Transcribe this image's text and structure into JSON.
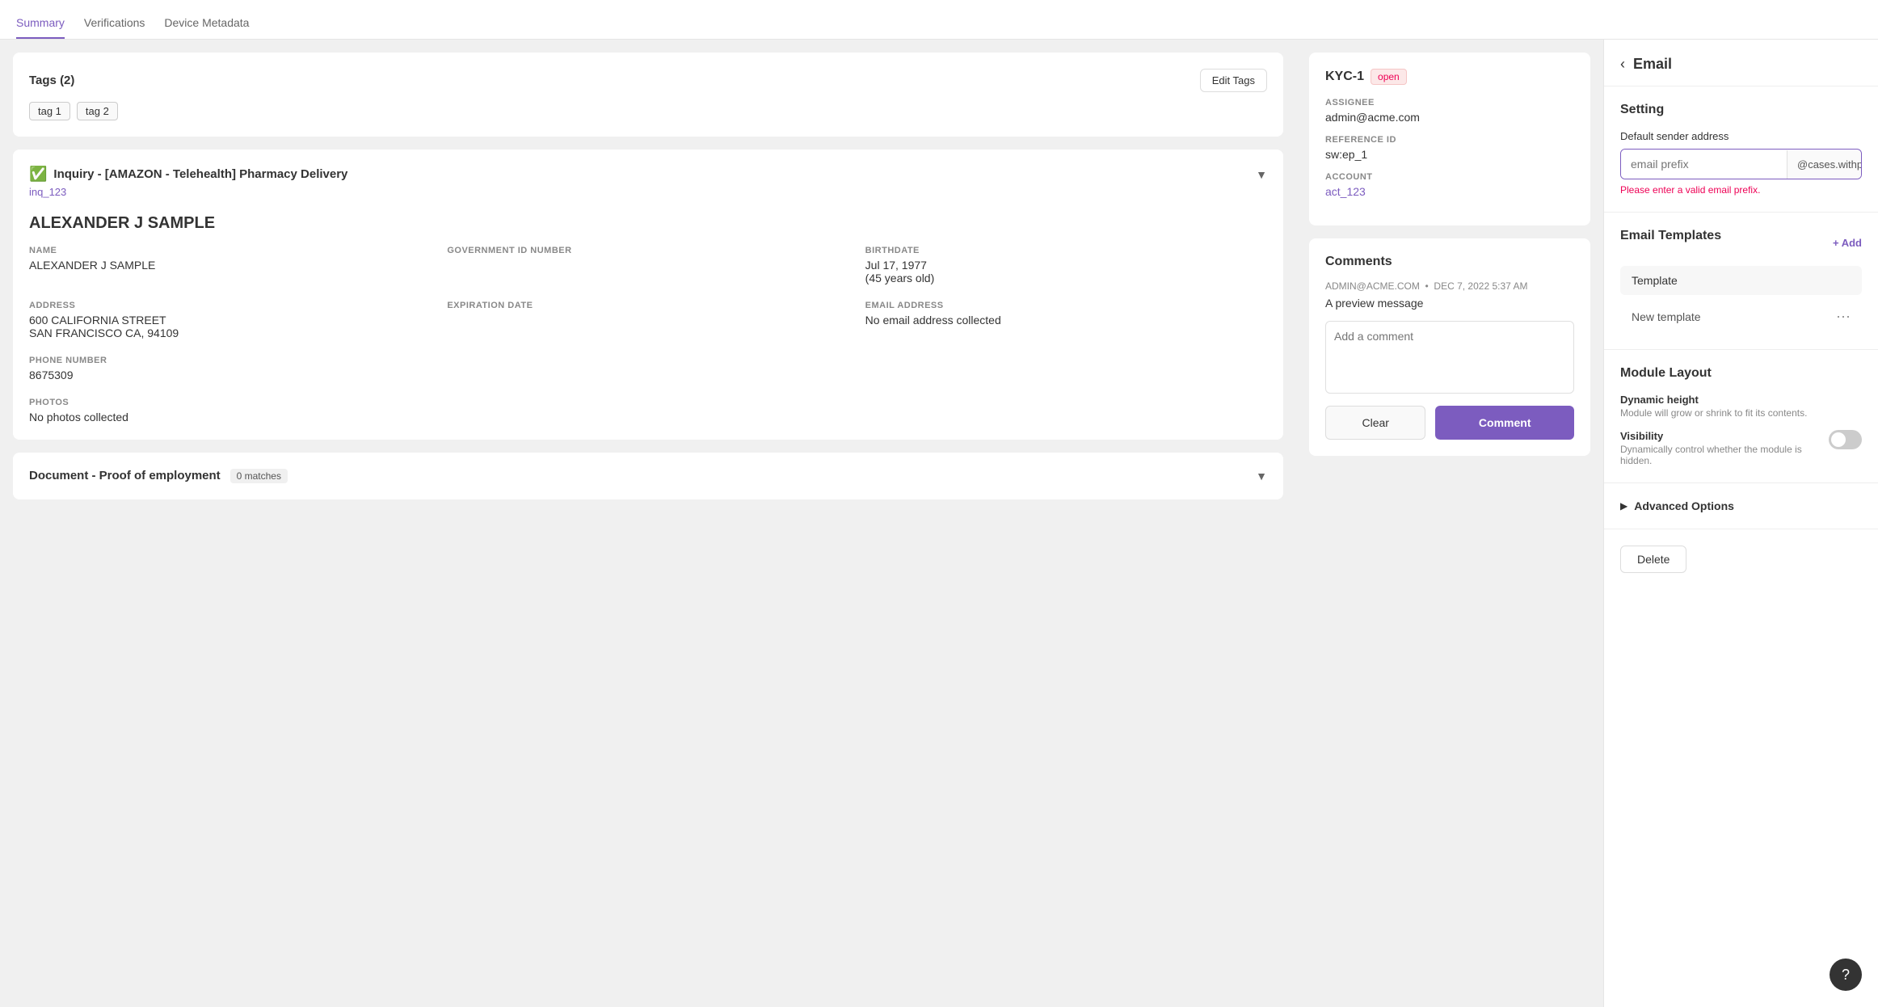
{
  "tabs": [
    {
      "id": "summary",
      "label": "Summary",
      "active": true
    },
    {
      "id": "verifications",
      "label": "Verifications",
      "active": false
    },
    {
      "id": "device-metadata",
      "label": "Device Metadata",
      "active": false
    }
  ],
  "tags_card": {
    "title": "Tags (2)",
    "edit_button": "Edit Tags",
    "tags": [
      "tag 1",
      "tag 2"
    ]
  },
  "inquiry_card": {
    "title": "Inquiry - [AMAZON - Telehealth] Pharmacy Delivery",
    "link_text": "inq_123"
  },
  "person": {
    "name": "ALEXANDER J SAMPLE",
    "fields": [
      {
        "label": "NAME",
        "value": "ALEXANDER J SAMPLE"
      },
      {
        "label": "GOVERNMENT ID NUMBER",
        "value": ""
      },
      {
        "label": "BIRTHDATE",
        "value": "Jul 17, 1977\n(45 years old)"
      },
      {
        "label": "ADDRESS",
        "value": "600 CALIFORNIA STREET\nSAN FRANCISCO CA, 94109"
      },
      {
        "label": "EXPIRATION DATE",
        "value": ""
      },
      {
        "label": "EMAIL ADDRESS",
        "value": "No email address collected"
      },
      {
        "label": "PHONE NUMBER",
        "value": "8675309"
      }
    ]
  },
  "photos": {
    "label": "PHOTOS",
    "value": "No photos collected"
  },
  "document_card": {
    "title": "Document - Proof of employment",
    "badge": "0 matches"
  },
  "kyc_card": {
    "id": "KYC-1",
    "status": "open",
    "assignee_label": "ASSIGNEE",
    "assignee_value": "admin@acme.com",
    "reference_label": "REFERENCE ID",
    "reference_value": "sw:ep_1",
    "account_label": "ACCOUNT",
    "account_link": "act_123"
  },
  "comments": {
    "title": "Comments",
    "author": "ADMIN@ACME.COM",
    "date": "DEC 7, 2022 5:37 AM",
    "message": "A preview message",
    "textarea_placeholder": "Add a comment",
    "clear_button": "Clear",
    "comment_button": "Comment"
  },
  "right_panel": {
    "back_icon": "‹",
    "title": "Email",
    "setting_section": {
      "title": "Setting",
      "sender_label": "Default sender address",
      "email_prefix_placeholder": "email prefix",
      "email_suffix": "@cases.withpersona.com",
      "error_text": "Please enter a valid email prefix."
    },
    "email_templates": {
      "title": "Email Templates",
      "add_button": "+ Add",
      "template_item": "Template",
      "new_template_item": "New template",
      "new_template_menu": "···"
    },
    "module_layout": {
      "title": "Module Layout",
      "dynamic_height_title": "Dynamic height",
      "dynamic_height_desc": "Module will grow or shrink to fit its contents.",
      "visibility_title": "Visibility",
      "visibility_desc": "Dynamically control whether the module is hidden."
    },
    "advanced_options": {
      "title": "Advanced Options",
      "arrow": "▶"
    },
    "delete_button": "Delete"
  },
  "help": {
    "icon": "?"
  }
}
